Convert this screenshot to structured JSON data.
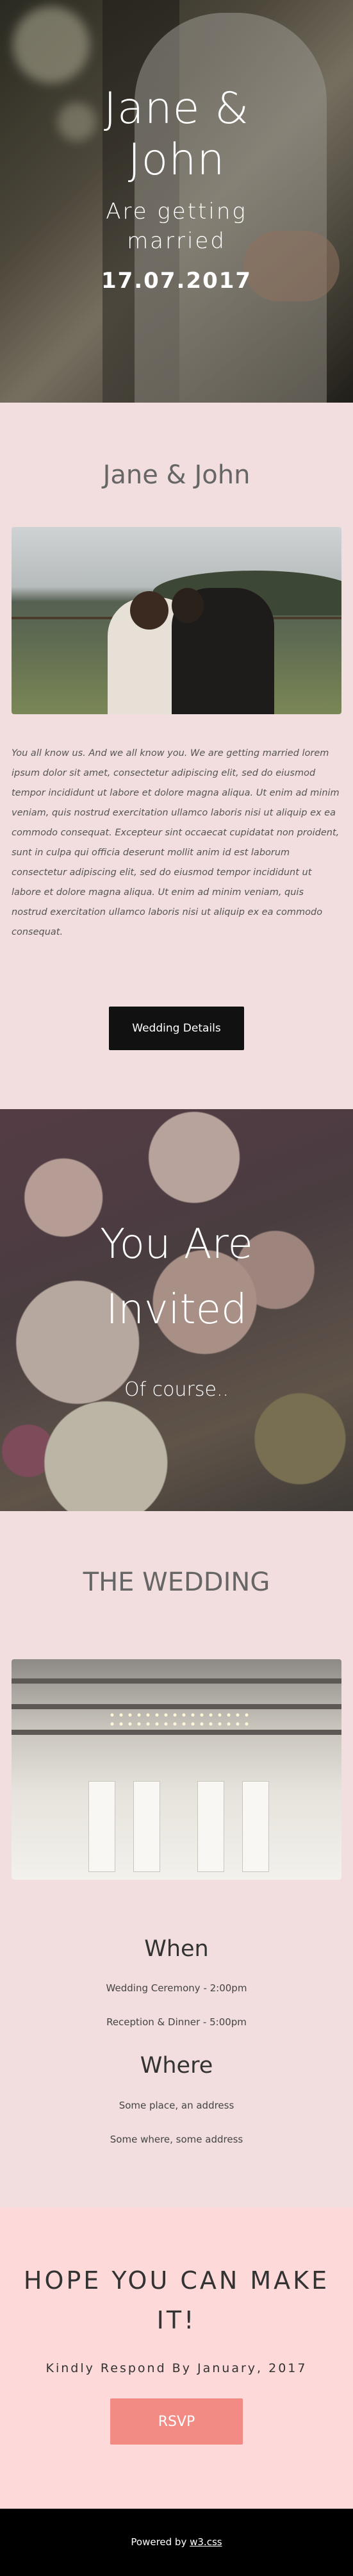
{
  "hero": {
    "names": "Jane & John",
    "subtitle": "Are getting married",
    "date": "17.07.2017"
  },
  "about": {
    "heading": "Jane & John",
    "body": "You all know us. And we all know you. We are getting married lorem ipsum dolor sit amet, consectetur adipiscing elit, sed do eiusmod tempor incididunt ut labore et dolore magna aliqua. Ut enim ad minim veniam, quis nostrud exercitation ullamco laboris nisi ut aliquip ex ea commodo consequat. Excepteur sint occaecat cupidatat non proident, sunt in culpa qui officia deserunt mollit anim id est laborum consectetur adipiscing elit, sed do eiusmod tempor incididunt ut labore et dolore magna aliqua. Ut enim ad minim veniam, quis nostrud exercitation ullamco laboris nisi ut aliquip ex ea commodo consequat.",
    "button": "Wedding Details"
  },
  "invited": {
    "title": "You Are Invited",
    "subtitle": "Of course.."
  },
  "wedding": {
    "heading": "THE WEDDING",
    "when_heading": "When",
    "ceremony": "Wedding Ceremony - 2:00pm",
    "reception": "Reception & Dinner - 5:00pm",
    "where_heading": "Where",
    "place1": "Some place, an address",
    "place2": "Some where, some address"
  },
  "rsvp": {
    "heading": "HOPE YOU CAN MAKE IT!",
    "kindly": "Kindly Respond By January, 2017",
    "button": "RSVP"
  },
  "footer": {
    "prefix": "Powered by",
    "link": "w3.css"
  }
}
